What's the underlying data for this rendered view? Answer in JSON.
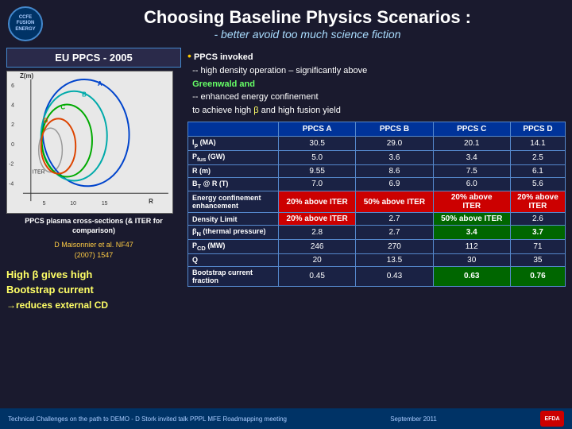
{
  "header": {
    "title": "Choosing Baseline Physics Scenarios :",
    "subtitle": "- better avoid too much science fiction",
    "logo_text": "CCFE\nFUSION\nENERGY"
  },
  "left_panel": {
    "eu_ppcs_label": "EU PPCS - 2005",
    "cross_section_label": "PPCS plasma cross-sections\n(& ITER for comparison)",
    "author_ref": "D Maisonnier et al. NF47\n(2007) 1547",
    "high_beta_line1": "High β gives high",
    "high_beta_line2": "Bootstrap current",
    "high_beta_line3": "→reduces external CD"
  },
  "bullet": {
    "title": "PPCS invoked",
    "line1": "-- high density operation – significantly above",
    "line2": "Greenwald and",
    "line3": "-- enhanced energy confinement",
    "line4": "to achieve high β and high fusion yield"
  },
  "table": {
    "headers": [
      "",
      "PPCS A",
      "PPCS B",
      "PPCS C",
      "PPCS D"
    ],
    "rows": [
      {
        "label": "Ip (MA)",
        "a": "30.5",
        "b": "29.0",
        "c": "20.1",
        "d": "14.1"
      },
      {
        "label": "Pfus (GW)",
        "a": "5.0",
        "b": "3.6",
        "c": "3.4",
        "d": "2.5"
      },
      {
        "label": "R (m)",
        "a": "9.55",
        "b": "8.6",
        "c": "7.5",
        "d": "6.1"
      },
      {
        "label": "BT @ R (T)",
        "a": "7.0",
        "b": "6.9",
        "c": "6.0",
        "d": "5.6"
      },
      {
        "label": "Energy confinement\nenhancement",
        "a": "20% above ITER",
        "b": "50% above ITER",
        "c": "20% above ITER",
        "d": "20% above ITER"
      },
      {
        "label": "Density Limit",
        "a": "20% above ITER",
        "b": "2.7",
        "c": "50% above ITER",
        "d": "2.6"
      },
      {
        "label": "βN (thermal pressure)",
        "a": "2.8",
        "b": "2.7",
        "c": "3.4",
        "d": "3.7"
      },
      {
        "label": "PCD (MW)",
        "a": "246",
        "b": "270",
        "c": "112",
        "d": "71"
      },
      {
        "label": "Q",
        "a": "20",
        "b": "13.5",
        "c": "30",
        "d": "35"
      },
      {
        "label": "Bootstrap current\nfraction",
        "a": "0.45",
        "b": "0.43",
        "c": "0.63",
        "d": "0.76"
      }
    ]
  },
  "footer": {
    "text": "Technical Challenges on the path to DEMO - D Stork  invited talk PPPL MFE Roadmapping meeting",
    "date": "September 2011",
    "logo": "EFDA"
  }
}
